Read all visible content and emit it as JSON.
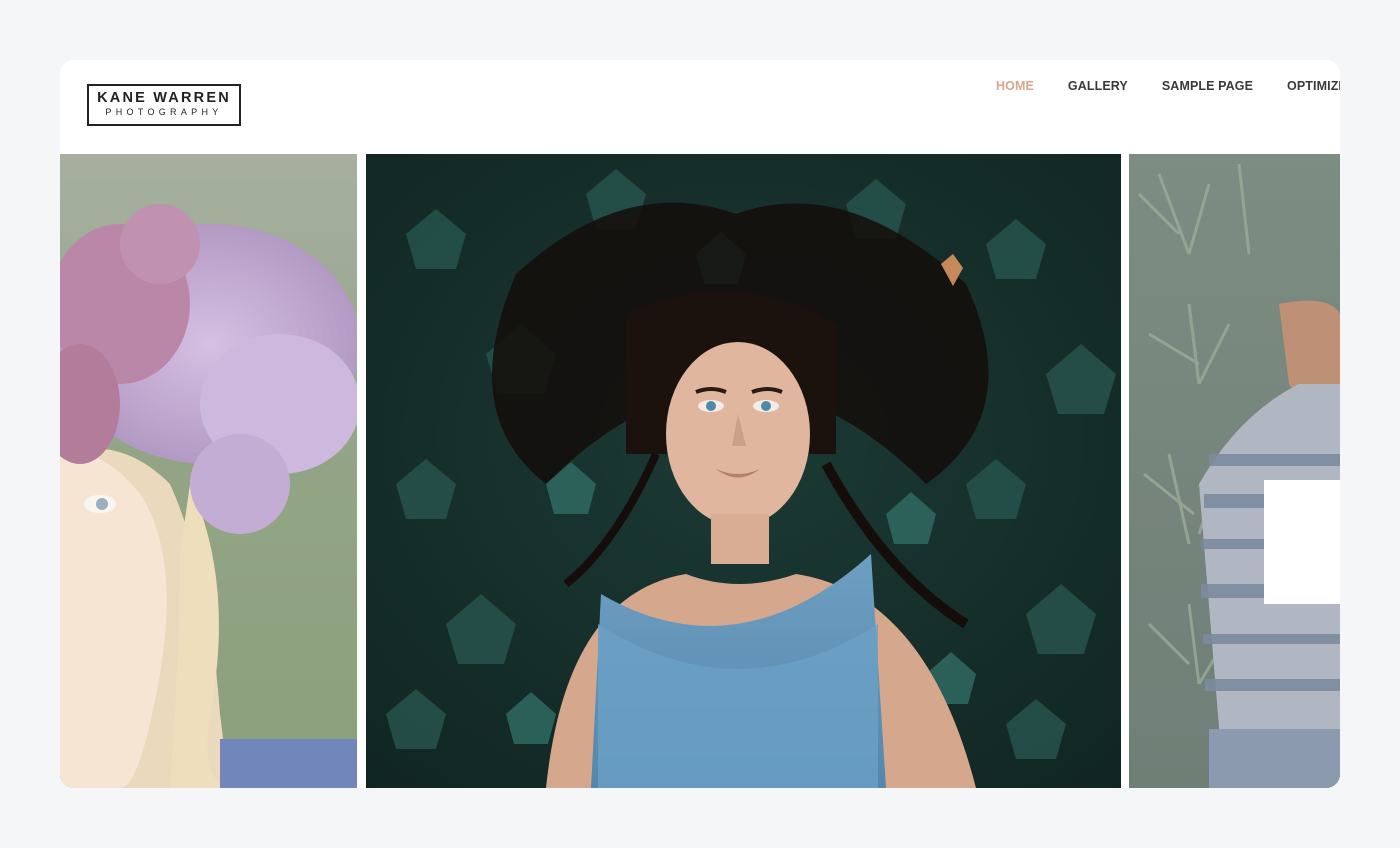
{
  "logo": {
    "name": "KANE WARREN",
    "tagline": "PHOTOGRAPHY"
  },
  "nav": {
    "items": [
      {
        "label": "HOME",
        "active": true
      },
      {
        "label": "GALLERY",
        "active": false
      },
      {
        "label": "SAMPLE PAGE",
        "active": false
      },
      {
        "label": "OPTIMIZER",
        "active": false
      }
    ]
  },
  "colors": {
    "page_background": "#f5f6f8",
    "nav_active": "#d8a88c",
    "nav_text": "#3a3a3a"
  },
  "slider": {
    "slides": [
      {
        "position": "previous",
        "subject": "woman-with-lilac-flower-crown"
      },
      {
        "position": "current",
        "subject": "woman-lying-in-ivy"
      },
      {
        "position": "next",
        "subject": "woman-in-striped-sweater-among-pines"
      }
    ]
  }
}
